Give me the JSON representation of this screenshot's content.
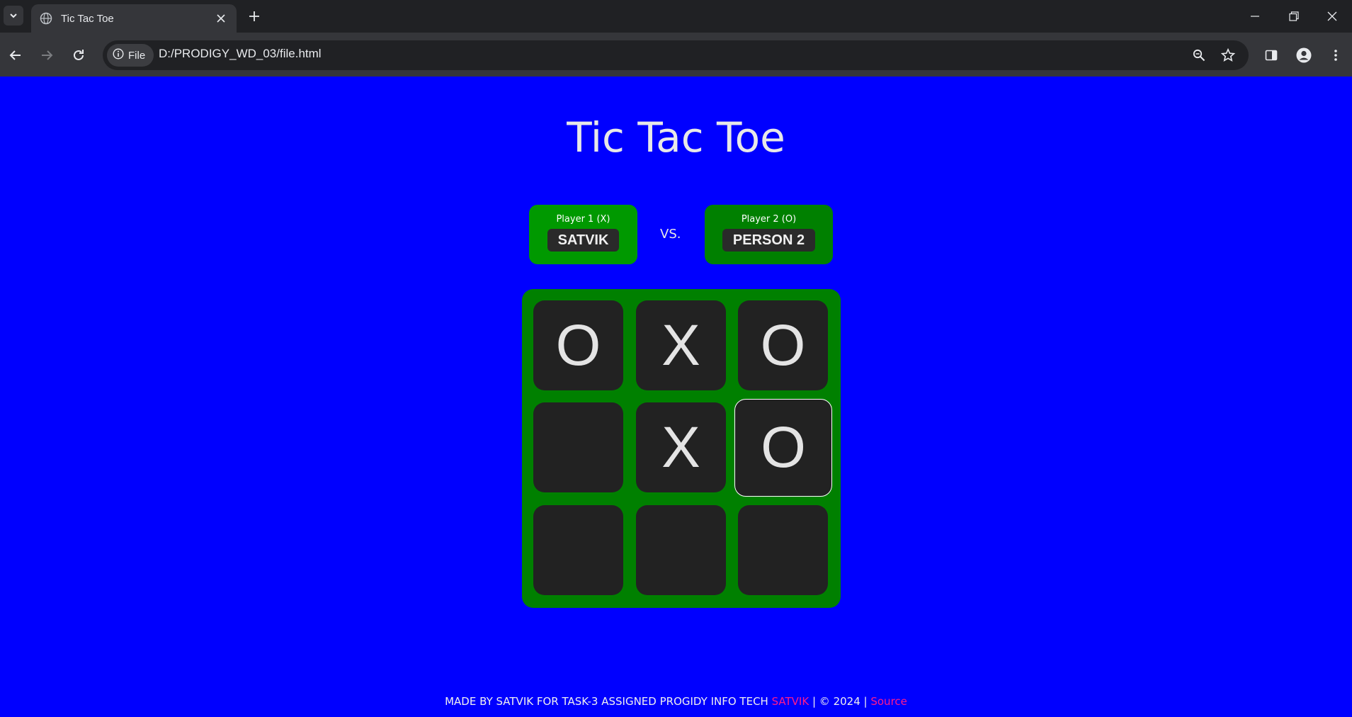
{
  "browser": {
    "tab_title": "Tic Tac Toe",
    "file_chip_label": "File",
    "url": "D:/PRODIGY_WD_03/file.html",
    "icons": [
      "tab-search-icon",
      "globe-icon",
      "close-icon",
      "plus-icon",
      "minimize-icon",
      "restore-icon",
      "window-close-icon",
      "back-icon",
      "forward-icon",
      "reload-icon",
      "info-icon",
      "zoom-icon",
      "star-icon",
      "side-panel-icon",
      "profile-icon",
      "menu-icon"
    ]
  },
  "game": {
    "title": "Tic Tac Toe",
    "player1": {
      "label": "Player 1 (X)",
      "name": "SATVIK"
    },
    "vs": "VS.",
    "player2": {
      "label": "Player 2 (O)",
      "name": "PERSON 2"
    },
    "board": [
      [
        "O",
        "X",
        "O"
      ],
      [
        "",
        "X",
        "O"
      ],
      [
        "",
        "",
        ""
      ]
    ]
  },
  "footer": {
    "text": "MADE BY SATVIK FOR TASK-3 ASSIGNED PROGIDY INFO TECH",
    "author": "SATVIK",
    "middle": "| © 2024 |",
    "source_link": "Source"
  },
  "colors": {
    "page_bg": "#0000ff",
    "board_bg": "#008000",
    "cell_bg": "#222222",
    "accent_link": "#ff1a8c"
  }
}
